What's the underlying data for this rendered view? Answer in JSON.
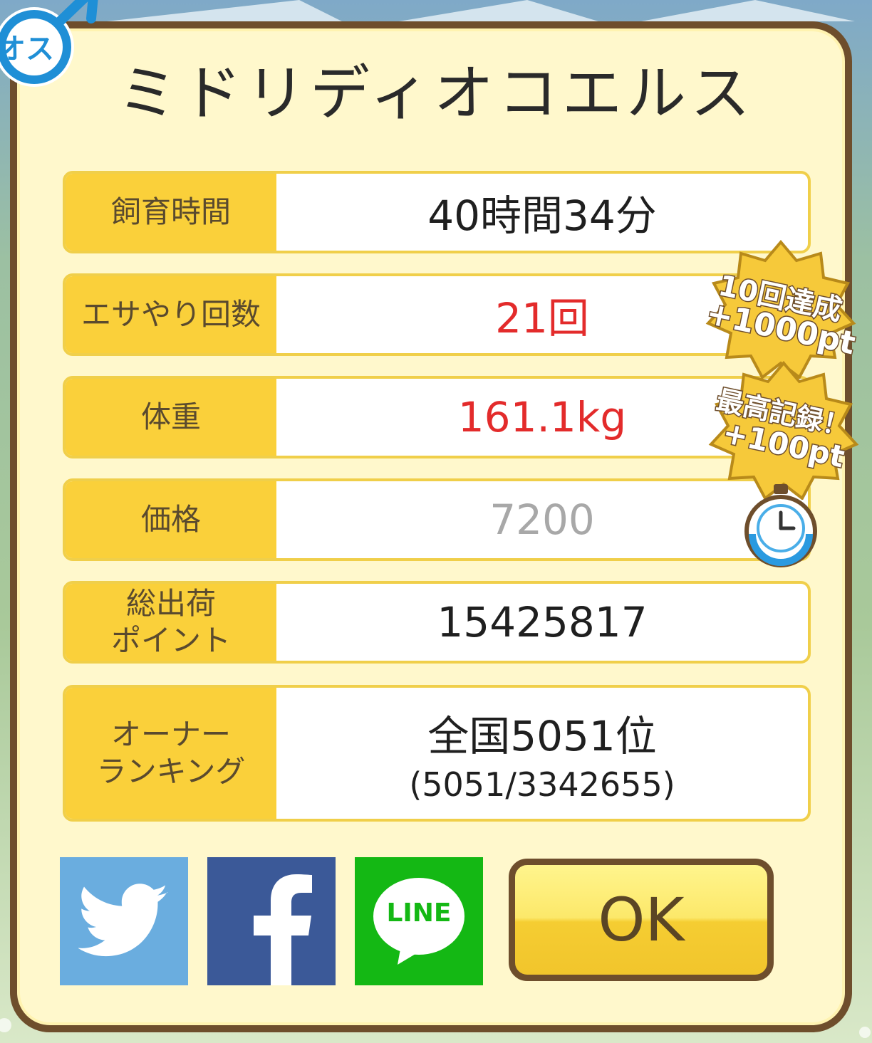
{
  "header": {
    "title": "ミドリディオコエルス",
    "gender_badge": "オス"
  },
  "stats": [
    {
      "label": "飼育時間",
      "value": "40時間34分",
      "value_color": "#1f1f1f"
    },
    {
      "label": "エサやり回数",
      "value": "21回",
      "value_color": "#e32b2b"
    },
    {
      "label": "体重",
      "value": "161.1kg",
      "value_color": "#e32b2b"
    },
    {
      "label": "価格",
      "value": "7200",
      "value_color": "#a8a8a8"
    },
    {
      "label": "総出荷\nポイント",
      "value": "15425817",
      "value_color": "#1f1f1f"
    },
    {
      "label": "オーナー\nランキング",
      "value": "全国5051位",
      "sub_value": "(5051/3342655)",
      "value_color": "#1f1f1f"
    }
  ],
  "medals": [
    {
      "line1": "10回達成",
      "line2": "+1000pt"
    },
    {
      "line1": "最高記録！",
      "line2": "+100pt"
    }
  ],
  "share": {
    "twitter_icon": "twitter-icon",
    "facebook_icon": "facebook-icon",
    "line_label": "LINE"
  },
  "ok_label": "OK",
  "colors": {
    "frame": "#6e4e2c",
    "panel": "#fff8cc",
    "label_bg": "#fad03a",
    "twitter": "#6aaddf",
    "facebook": "#3b5998",
    "line": "#14b814",
    "accent_red": "#e32b2b"
  }
}
